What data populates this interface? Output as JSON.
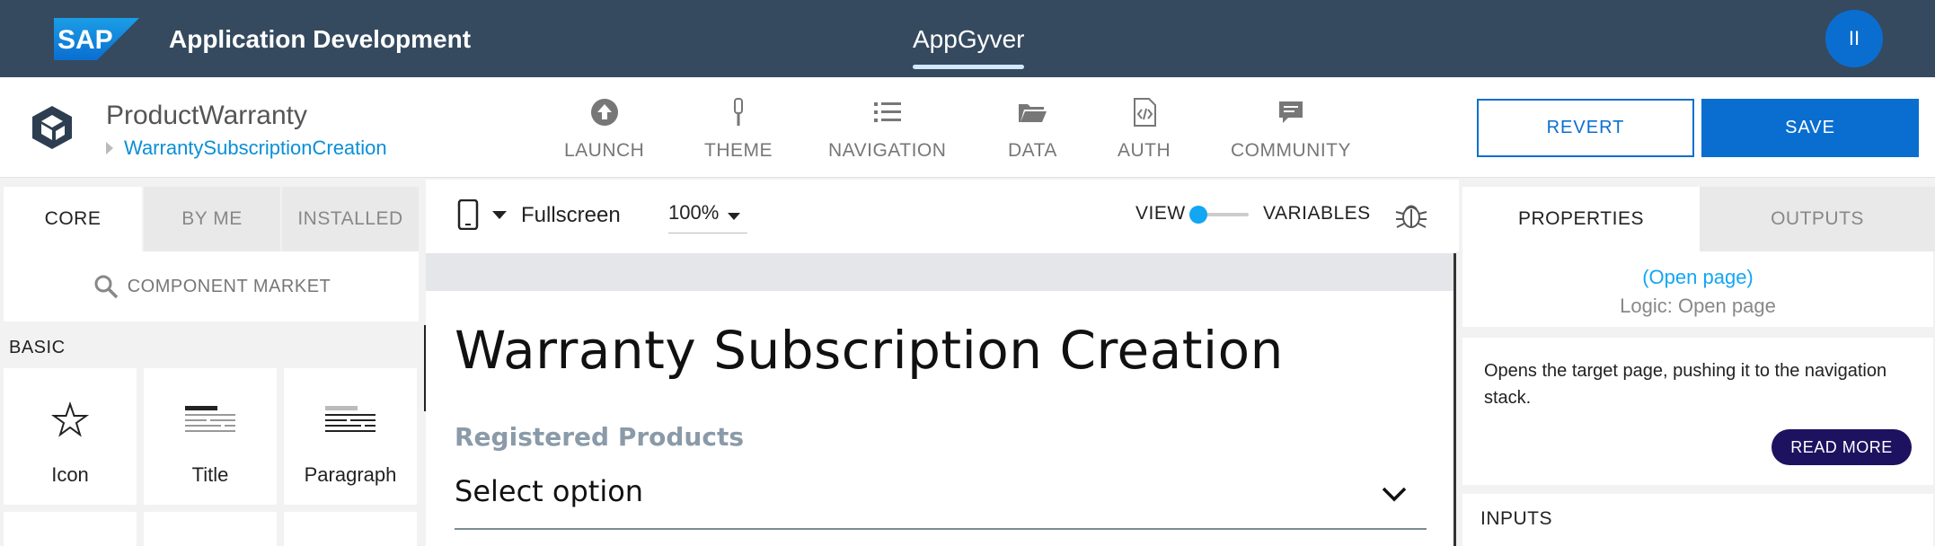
{
  "topbar": {
    "brand": "SAP",
    "app_title": "Application Development",
    "active_tab": "AppGyver",
    "user_initials": "II"
  },
  "project": {
    "name": "ProductWarranty",
    "page": "WarrantySubscriptionCreation"
  },
  "nav": [
    {
      "label": "LAUNCH",
      "icon": "upload-circle-icon"
    },
    {
      "label": "THEME",
      "icon": "brush-icon"
    },
    {
      "label": "NAVIGATION",
      "icon": "list-icon"
    },
    {
      "label": "DATA",
      "icon": "folder-icon"
    },
    {
      "label": "AUTH",
      "icon": "code-file-icon"
    },
    {
      "label": "COMMUNITY",
      "icon": "chat-bubble-icon"
    }
  ],
  "actions": {
    "revert": "REVERT",
    "save": "SAVE"
  },
  "left_panel": {
    "tabs": [
      "CORE",
      "BY ME",
      "INSTALLED"
    ],
    "active_tab": "CORE",
    "market_label": "COMPONENT MARKET",
    "section": "BASIC",
    "components": [
      {
        "label": "Icon",
        "icon": "star-icon"
      },
      {
        "label": "Title",
        "icon": "title-lines-icon"
      },
      {
        "label": "Paragraph",
        "icon": "paragraph-lines-icon"
      }
    ]
  },
  "canvas_toolbar": {
    "device": "Fullscreen",
    "zoom": "100%",
    "view_label": "VIEW",
    "variables_label": "VARIABLES"
  },
  "canvas": {
    "heading": "Warranty Subscription Creation",
    "field_label": "Registered Products",
    "select_placeholder": "Select option"
  },
  "right_panel": {
    "tabs": [
      "PROPERTIES",
      "OUTPUTS"
    ],
    "active_tab": "PROPERTIES",
    "logic_link": "(Open page)",
    "logic_sub": "Logic: Open page",
    "description": "Opens the target page, pushing it to the navigation stack.",
    "read_more": "READ MORE",
    "inputs_label": "INPUTS"
  },
  "colors": {
    "shell": "#354a5f",
    "accent_blue": "#0a6ed1",
    "link_blue": "#13a6f2",
    "readmore_bg": "#1d1260"
  }
}
